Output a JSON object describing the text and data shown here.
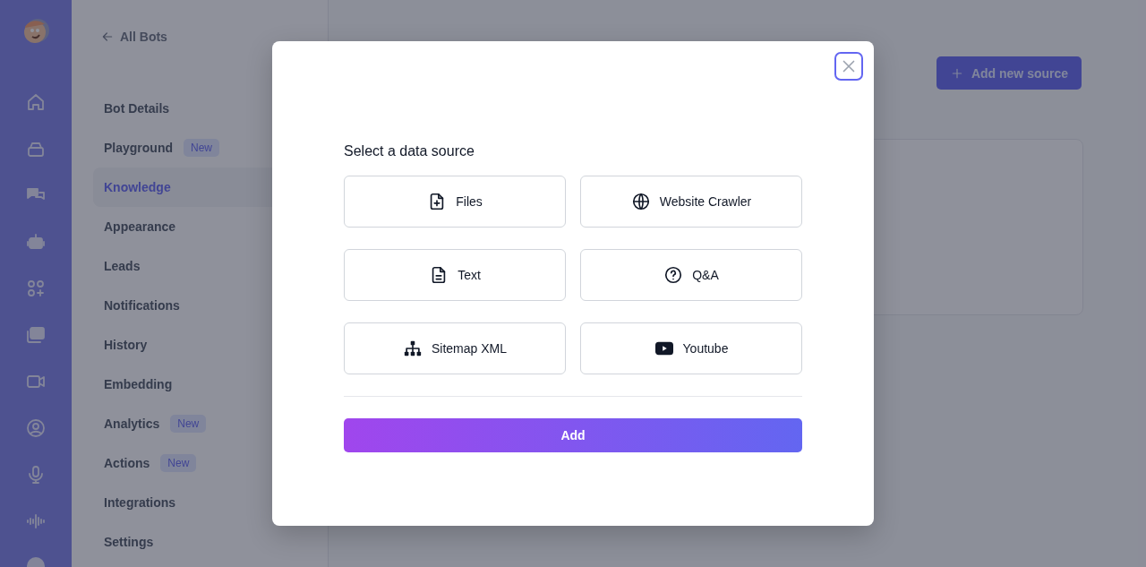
{
  "back_link": "All Bots",
  "menu": [
    {
      "label": "Bot Details",
      "selected": false
    },
    {
      "label": "Playground",
      "selected": false,
      "badge": "New"
    },
    {
      "label": "Knowledge",
      "selected": true
    },
    {
      "label": "Appearance",
      "selected": false
    },
    {
      "label": "Leads",
      "selected": false
    },
    {
      "label": "Notifications",
      "selected": false
    },
    {
      "label": "History",
      "selected": false
    },
    {
      "label": "Embedding",
      "selected": false
    },
    {
      "label": "Analytics",
      "selected": false,
      "badge": "New"
    },
    {
      "label": "Actions",
      "selected": false,
      "badge": "New"
    },
    {
      "label": "Integrations",
      "selected": false
    },
    {
      "label": "Settings",
      "selected": false
    }
  ],
  "add_source_button": "Add new source",
  "dialog": {
    "title": "Select a data source",
    "sources": [
      {
        "label": "Files"
      },
      {
        "label": "Website Crawler"
      },
      {
        "label": "Text"
      },
      {
        "label": "Q&A"
      },
      {
        "label": "Sitemap XML"
      },
      {
        "label": "Youtube"
      }
    ],
    "submit": "Add"
  }
}
